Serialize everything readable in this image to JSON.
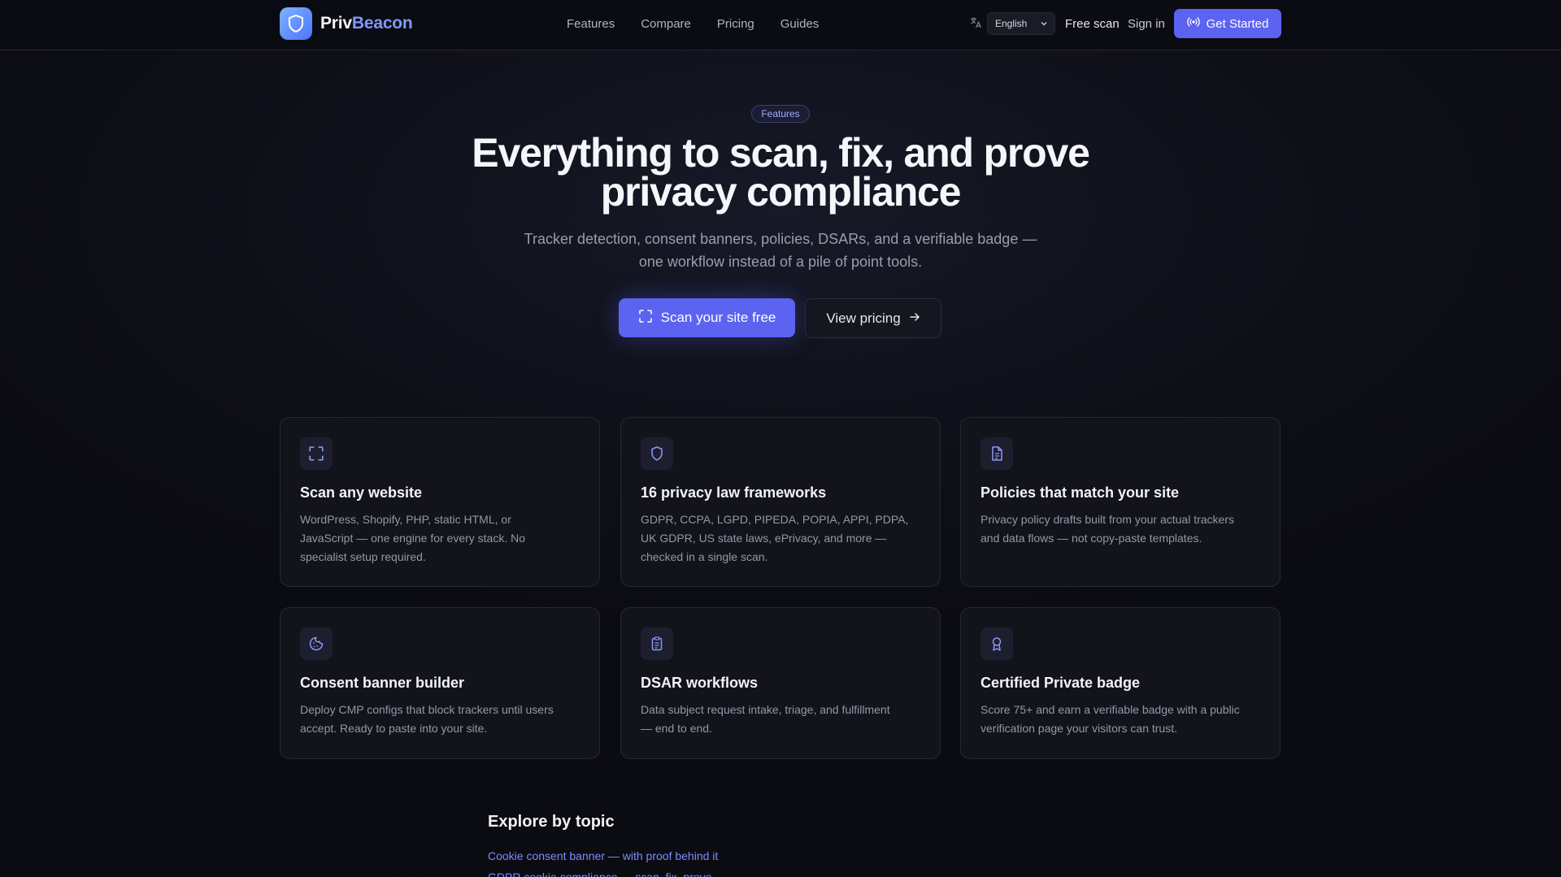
{
  "brand": {
    "name_part1": "Priv",
    "name_part2": "Beacon"
  },
  "nav": {
    "links": [
      "Features",
      "Compare",
      "Pricing",
      "Guides"
    ],
    "language": "English",
    "free_scan": "Free scan",
    "sign_in": "Sign in",
    "get_started": "Get Started"
  },
  "hero": {
    "badge": "Features",
    "title_line1": "Everything to scan, fix, and prove",
    "title_line2": "privacy compliance",
    "subtitle_line1": "Tracker detection, consent banners, policies, DSARs, and a verifiable badge —",
    "subtitle_line2": "one workflow instead of a pile of point tools.",
    "primary_cta": "Scan your site free",
    "secondary_cta": "View pricing"
  },
  "features": [
    {
      "icon": "scan-icon",
      "title": "Scan any website",
      "lines": [
        "WordPress, Shopify, PHP, static HTML, or",
        "JavaScript — one engine for every stack. No",
        "specialist setup required."
      ]
    },
    {
      "icon": "shield-icon",
      "title": "16 privacy law frameworks",
      "lines": [
        "GDPR, CCPA, LGPD, PIPEDA, POPIA, APPI, PDPA,",
        "UK GDPR, US state laws, ePrivacy, and more —",
        "checked in a single scan."
      ]
    },
    {
      "icon": "document-icon",
      "title": "Policies that match your site",
      "lines": [
        "Privacy policy drafts built from your actual trackers",
        "and data flows — not copy-paste templates."
      ]
    },
    {
      "icon": "cookie-icon",
      "title": "Consent banner builder",
      "lines": [
        "Deploy CMP configs that block trackers until users",
        "accept. Ready to paste into your site."
      ]
    },
    {
      "icon": "clipboard-icon",
      "title": "DSAR workflows",
      "lines": [
        "Data subject request intake, triage, and fulfillment",
        "— end to end."
      ]
    },
    {
      "icon": "award-icon",
      "title": "Certified Private badge",
      "lines": [
        "Score 75+ and earn a verifiable badge with a public",
        "verification page your visitors can trust."
      ]
    }
  ],
  "topics": {
    "title": "Explore by topic",
    "links": [
      "Cookie consent banner — with proof behind it",
      "GDPR cookie compliance — scan, fix, prove"
    ]
  },
  "colors": {
    "accent": "#5b63f0",
    "background": "#0b0b12",
    "card": "#12131b",
    "link": "#7d8cff"
  }
}
